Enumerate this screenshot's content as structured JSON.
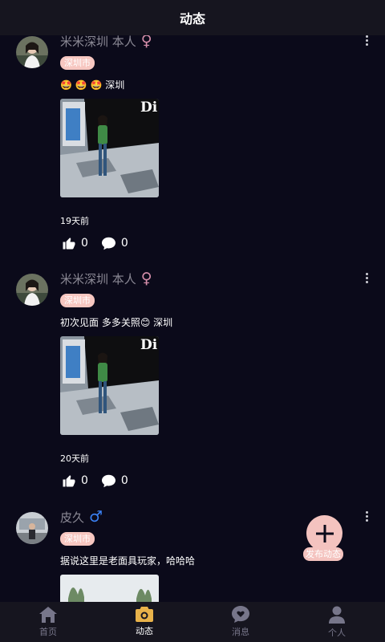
{
  "header": {
    "title": "动态"
  },
  "posts": [
    {
      "name": "米米深圳 本人",
      "gender_symbol": "♀",
      "city": "深圳市",
      "content": "🤩 🤩 🤩 深圳",
      "time": "19天前",
      "likes": "0",
      "comments": "0",
      "photo_text": "Di"
    },
    {
      "name": "米米深圳 本人",
      "gender_symbol": "♀",
      "city": "深圳市",
      "content": "初次见面 多多关照😊 深圳",
      "time": "20天前",
      "likes": "0",
      "comments": "0",
      "photo_text": "Di"
    },
    {
      "name": "皮久",
      "gender_symbol": "♂",
      "city": "深圳市",
      "content": "据说这里是老面具玩家，哈哈哈"
    }
  ],
  "fab": {
    "label": "发布动态"
  },
  "tabbar": {
    "items": [
      {
        "label": "首页"
      },
      {
        "label": "动态"
      },
      {
        "label": "消息"
      },
      {
        "label": "个人"
      }
    ]
  },
  "colors": {
    "background": "#0b0a1a",
    "bar": "#16151f",
    "accent_pink": "#f7c7c1",
    "female": "#d58eaa",
    "male": "#3b82f6",
    "tab_active_icon": "#e8b24a"
  }
}
